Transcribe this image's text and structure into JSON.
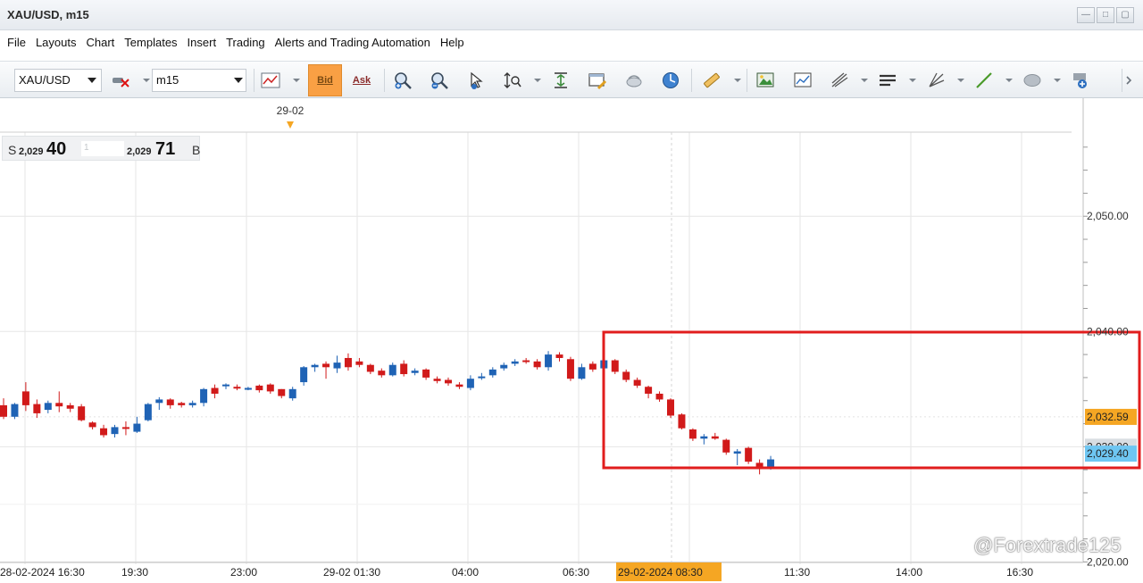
{
  "window": {
    "title": "XAU/USD, m15"
  },
  "menu": [
    "File",
    "Layouts",
    "Chart",
    "Templates",
    "Insert",
    "Trading",
    "Alerts and Trading Automation",
    "Help"
  ],
  "toolbar": {
    "symbol": "XAU/USD",
    "timeframe": "m15",
    "bid_label": "Bid",
    "ask_label": "Ask",
    "bid_selected": true
  },
  "price_panel": {
    "sell_label": "S",
    "sell_prefix": "2,029",
    "sell_suffix": "40",
    "spread_placeholder": "1",
    "buy_prefix": "2,029",
    "buy_suffix": "71",
    "buy_label": "B"
  },
  "chart": {
    "top_date_marker": "29-02",
    "y_labels": [
      "2,050.00",
      "2,040.00",
      "2,020.00"
    ],
    "x_labels": [
      "28-02-2024 16:30",
      "19:30",
      "23:00",
      "29-02 01:30",
      "04:00",
      "06:30",
      "29-02-2024 08:30",
      "11:30",
      "14:00",
      "16:30"
    ],
    "highlighted_time": "29-02-2024 08:30",
    "price_tags": [
      {
        "text": "2,032.59",
        "color": "#f5a623"
      },
      {
        "text": "2,029.40",
        "color": "#6ec6f2"
      },
      {
        "text": "2,030.00",
        "color": "#d8dde2"
      }
    ],
    "colors": {
      "bull": "#1f63b5",
      "bear": "#d11a1a",
      "highlight_box": "#e11d1d",
      "grid": "#e6e6e6"
    }
  },
  "chart_data": {
    "type": "candlestick",
    "symbol": "XAU/USD",
    "timeframe": "m15",
    "y_ticks": [
      2020,
      2030,
      2040,
      2050
    ],
    "ylim": [
      2019.8,
      2057.3
    ],
    "ask_line": 2032.59,
    "bid_line": 2029.4,
    "candles": [
      {
        "o": 2033.6,
        "c": 2032.6,
        "h": 2034.2,
        "l": 2032.4
      },
      {
        "o": 2032.6,
        "c": 2033.7,
        "h": 2033.8,
        "l": 2032.4
      },
      {
        "o": 2034.8,
        "c": 2033.6,
        "h": 2035.6,
        "l": 2033.1
      },
      {
        "o": 2033.7,
        "c": 2032.9,
        "h": 2034.1,
        "l": 2032.5
      },
      {
        "o": 2033.2,
        "c": 2033.8,
        "h": 2034.0,
        "l": 2032.9
      },
      {
        "o": 2033.8,
        "c": 2033.5,
        "h": 2034.8,
        "l": 2033.0
      },
      {
        "o": 2033.6,
        "c": 2033.3,
        "h": 2033.8,
        "l": 2033.0
      },
      {
        "o": 2033.5,
        "c": 2032.3,
        "h": 2033.7,
        "l": 2032.2
      },
      {
        "o": 2032.1,
        "c": 2031.7,
        "h": 2032.2,
        "l": 2031.5
      },
      {
        "o": 2031.6,
        "c": 2031.0,
        "h": 2031.9,
        "l": 2030.8
      },
      {
        "o": 2031.1,
        "c": 2031.7,
        "h": 2031.9,
        "l": 2030.8
      },
      {
        "o": 2031.7,
        "c": 2031.6,
        "h": 2032.2,
        "l": 2031.0
      },
      {
        "o": 2031.3,
        "c": 2032.0,
        "h": 2032.6,
        "l": 2031.2
      },
      {
        "o": 2032.3,
        "c": 2033.7,
        "h": 2033.8,
        "l": 2032.2
      },
      {
        "o": 2033.8,
        "c": 2034.1,
        "h": 2034.3,
        "l": 2033.2
      },
      {
        "o": 2034.1,
        "c": 2033.6,
        "h": 2034.2,
        "l": 2033.3
      },
      {
        "o": 2033.8,
        "c": 2033.6,
        "h": 2033.9,
        "l": 2033.4
      },
      {
        "o": 2033.6,
        "c": 2033.8,
        "h": 2034.0,
        "l": 2033.4
      },
      {
        "o": 2033.8,
        "c": 2035.0,
        "h": 2035.1,
        "l": 2033.5
      },
      {
        "o": 2035.1,
        "c": 2034.6,
        "h": 2035.4,
        "l": 2034.2
      },
      {
        "o": 2035.3,
        "c": 2035.4,
        "h": 2035.5,
        "l": 2035.0
      },
      {
        "o": 2035.2,
        "c": 2035.1,
        "h": 2035.4,
        "l": 2034.9
      },
      {
        "o": 2035.0,
        "c": 2035.1,
        "h": 2035.2,
        "l": 2034.9
      },
      {
        "o": 2035.3,
        "c": 2034.9,
        "h": 2035.4,
        "l": 2034.7
      },
      {
        "o": 2035.4,
        "c": 2034.8,
        "h": 2035.5,
        "l": 2034.6
      },
      {
        "o": 2035.0,
        "c": 2034.4,
        "h": 2035.0,
        "l": 2034.2
      },
      {
        "o": 2034.2,
        "c": 2035.0,
        "h": 2035.2,
        "l": 2034.0
      },
      {
        "o": 2035.6,
        "c": 2036.9,
        "h": 2037.0,
        "l": 2035.3
      },
      {
        "o": 2036.9,
        "c": 2037.1,
        "h": 2037.2,
        "l": 2036.5
      },
      {
        "o": 2037.2,
        "c": 2036.9,
        "h": 2037.4,
        "l": 2035.9
      },
      {
        "o": 2036.8,
        "c": 2037.3,
        "h": 2037.9,
        "l": 2036.4
      },
      {
        "o": 2037.7,
        "c": 2036.9,
        "h": 2038.1,
        "l": 2036.6
      },
      {
        "o": 2037.4,
        "c": 2037.1,
        "h": 2037.7,
        "l": 2036.9
      },
      {
        "o": 2037.1,
        "c": 2036.5,
        "h": 2037.2,
        "l": 2036.3
      },
      {
        "o": 2036.6,
        "c": 2036.2,
        "h": 2036.8,
        "l": 2036.0
      },
      {
        "o": 2036.2,
        "c": 2037.1,
        "h": 2037.3,
        "l": 2036.1
      },
      {
        "o": 2037.2,
        "c": 2036.3,
        "h": 2037.5,
        "l": 2036.1
      },
      {
        "o": 2036.4,
        "c": 2036.6,
        "h": 2036.8,
        "l": 2036.2
      },
      {
        "o": 2036.7,
        "c": 2036.0,
        "h": 2036.8,
        "l": 2035.8
      },
      {
        "o": 2035.9,
        "c": 2035.7,
        "h": 2036.1,
        "l": 2035.5
      },
      {
        "o": 2035.8,
        "c": 2035.5,
        "h": 2036.0,
        "l": 2035.3
      },
      {
        "o": 2035.4,
        "c": 2035.2,
        "h": 2035.6,
        "l": 2035.0
      },
      {
        "o": 2035.1,
        "c": 2035.9,
        "h": 2036.2,
        "l": 2034.9
      },
      {
        "o": 2036.0,
        "c": 2036.1,
        "h": 2036.4,
        "l": 2035.8
      },
      {
        "o": 2036.2,
        "c": 2036.7,
        "h": 2036.9,
        "l": 2036.0
      },
      {
        "o": 2036.8,
        "c": 2037.1,
        "h": 2037.3,
        "l": 2036.6
      },
      {
        "o": 2037.2,
        "c": 2037.4,
        "h": 2037.6,
        "l": 2037.0
      },
      {
        "o": 2037.5,
        "c": 2037.4,
        "h": 2037.7,
        "l": 2037.2
      },
      {
        "o": 2037.4,
        "c": 2036.9,
        "h": 2037.6,
        "l": 2036.7
      },
      {
        "o": 2036.9,
        "c": 2038.0,
        "h": 2038.3,
        "l": 2036.6
      },
      {
        "o": 2038.0,
        "c": 2037.7,
        "h": 2038.2,
        "l": 2037.4
      },
      {
        "o": 2037.6,
        "c": 2035.9,
        "h": 2037.8,
        "l": 2035.7
      },
      {
        "o": 2035.9,
        "c": 2036.9,
        "h": 2037.2,
        "l": 2035.8
      },
      {
        "o": 2037.2,
        "c": 2036.7,
        "h": 2037.4,
        "l": 2036.5
      },
      {
        "o": 2036.8,
        "c": 2037.5,
        "h": 2037.7,
        "l": 2036.5
      },
      {
        "o": 2037.5,
        "c": 2036.5,
        "h": 2037.6,
        "l": 2036.3
      },
      {
        "o": 2036.5,
        "c": 2035.8,
        "h": 2036.7,
        "l": 2035.6
      },
      {
        "o": 2035.8,
        "c": 2035.3,
        "h": 2036.0,
        "l": 2035.1
      },
      {
        "o": 2035.2,
        "c": 2034.6,
        "h": 2035.3,
        "l": 2034.2
      },
      {
        "o": 2034.6,
        "c": 2034.1,
        "h": 2034.8,
        "l": 2033.9
      },
      {
        "o": 2034.1,
        "c": 2032.7,
        "h": 2034.2,
        "l": 2032.5
      },
      {
        "o": 2032.8,
        "c": 2031.6,
        "h": 2032.9,
        "l": 2031.5
      },
      {
        "o": 2031.5,
        "c": 2030.7,
        "h": 2031.6,
        "l": 2030.5
      },
      {
        "o": 2030.7,
        "c": 2030.9,
        "h": 2031.1,
        "l": 2030.2
      },
      {
        "o": 2030.9,
        "c": 2030.7,
        "h": 2031.2,
        "l": 2030.6
      },
      {
        "o": 2030.6,
        "c": 2029.5,
        "h": 2030.7,
        "l": 2029.3
      },
      {
        "o": 2029.4,
        "c": 2029.6,
        "h": 2029.8,
        "l": 2028.4
      },
      {
        "o": 2029.9,
        "c": 2028.7,
        "h": 2030.0,
        "l": 2028.5
      },
      {
        "o": 2028.6,
        "c": 2028.1,
        "h": 2028.9,
        "l": 2027.6
      },
      {
        "o": 2028.1,
        "c": 2028.9,
        "h": 2029.2,
        "l": 2028.0
      }
    ]
  }
}
